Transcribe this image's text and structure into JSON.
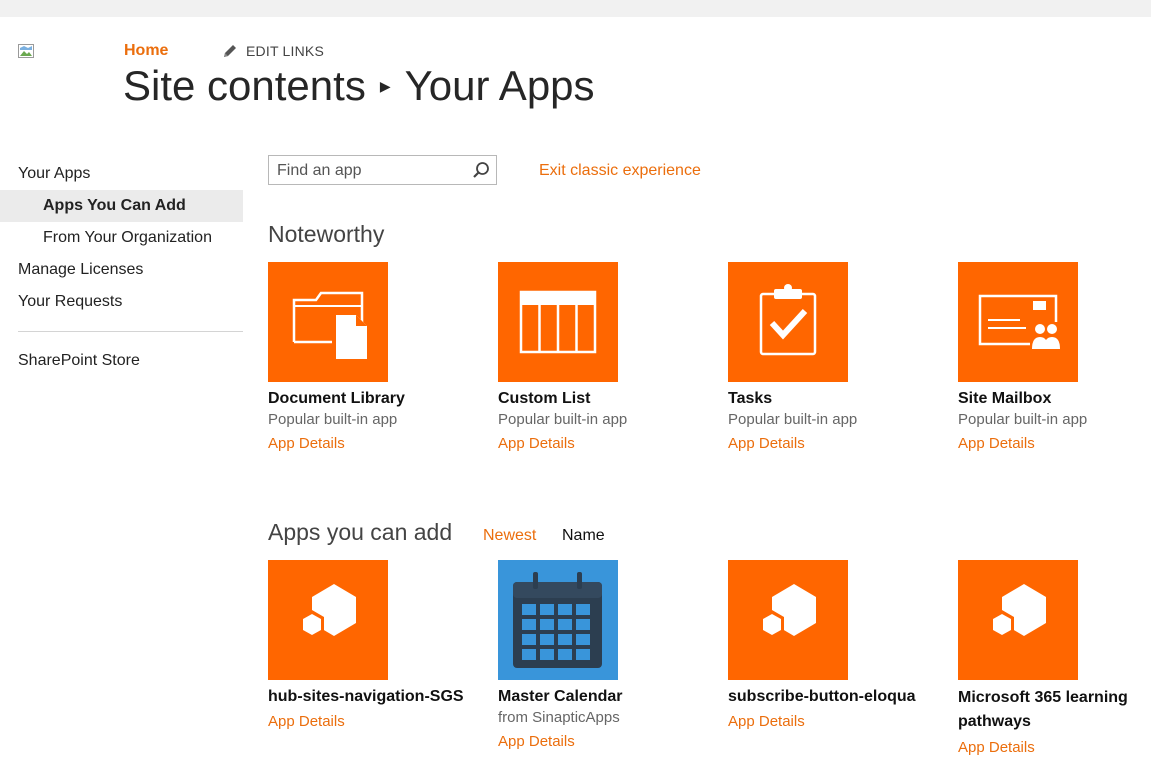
{
  "header": {
    "breadcrumb_home": "Home",
    "edit_links": "EDIT LINKS",
    "title_part1": "Site contents",
    "title_part2": "Your Apps"
  },
  "nav": {
    "items": [
      {
        "label": "Your Apps"
      },
      {
        "label": "Apps You Can Add"
      },
      {
        "label": "From Your Organization"
      },
      {
        "label": "Manage Licenses"
      },
      {
        "label": "Your Requests"
      },
      {
        "label": "SharePoint Store"
      }
    ]
  },
  "search": {
    "placeholder": "Find an app"
  },
  "exit_link": "Exit classic experience",
  "noteworthy": {
    "title": "Noteworthy",
    "apps": [
      {
        "name": "Document Library",
        "subtitle": "Popular built-in app",
        "details": "App Details",
        "icon": "document-library-icon"
      },
      {
        "name": "Custom List",
        "subtitle": "Popular built-in app",
        "details": "App Details",
        "icon": "custom-list-icon"
      },
      {
        "name": "Tasks",
        "subtitle": "Popular built-in app",
        "details": "App Details",
        "icon": "tasks-icon"
      },
      {
        "name": "Site Mailbox",
        "subtitle": "Popular built-in app",
        "details": "App Details",
        "icon": "site-mailbox-icon"
      }
    ]
  },
  "apps_you_can_add": {
    "title": "Apps you can add",
    "sort_newest": "Newest",
    "sort_name": "Name",
    "apps": [
      {
        "name": "hub-sites-navigation-SGS",
        "details": "App Details",
        "icon": "app-cubes-icon"
      },
      {
        "name": "Master Calendar",
        "subtitle": "from SinapticApps",
        "details": "App Details",
        "icon": "calendar-icon"
      },
      {
        "name": "subscribe-button-eloqua",
        "details": "App Details",
        "icon": "app-cubes-icon"
      },
      {
        "name": "Microsoft 365 learning pathways",
        "details": "App Details",
        "icon": "app-cubes-icon"
      }
    ]
  },
  "colors": {
    "accent": "#eb6e0d",
    "tile_orange": "#ff6600",
    "calendar_blue": "#3995da"
  }
}
